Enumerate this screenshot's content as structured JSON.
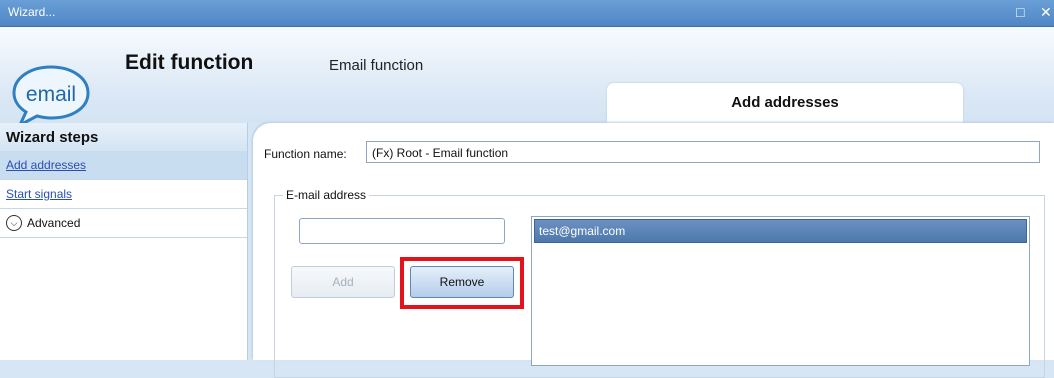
{
  "window": {
    "title": "Wizard...",
    "restore_icon": "□",
    "close_icon": "✕"
  },
  "header": {
    "logo_text": "email",
    "title": "Edit function",
    "subtitle": "Email function",
    "active_tab": "Add addresses"
  },
  "sidebar": {
    "caption": "Wizard steps",
    "items": [
      {
        "label": "Add addresses",
        "selected": true
      },
      {
        "label": "Start signals",
        "selected": false
      },
      {
        "label": "Advanced",
        "icon": "chevron-down-circle-icon"
      }
    ]
  },
  "form": {
    "function_name_label": "Function name:",
    "function_name_value": "(Fx) Root - Email function",
    "group_label": "E-mail address",
    "email_input_value": "",
    "add_label": "Add",
    "remove_label": "Remove",
    "addresses": [
      "test@gmail.com"
    ]
  },
  "colors": {
    "highlight": "#e3121b",
    "accent": "#4f86c4"
  }
}
